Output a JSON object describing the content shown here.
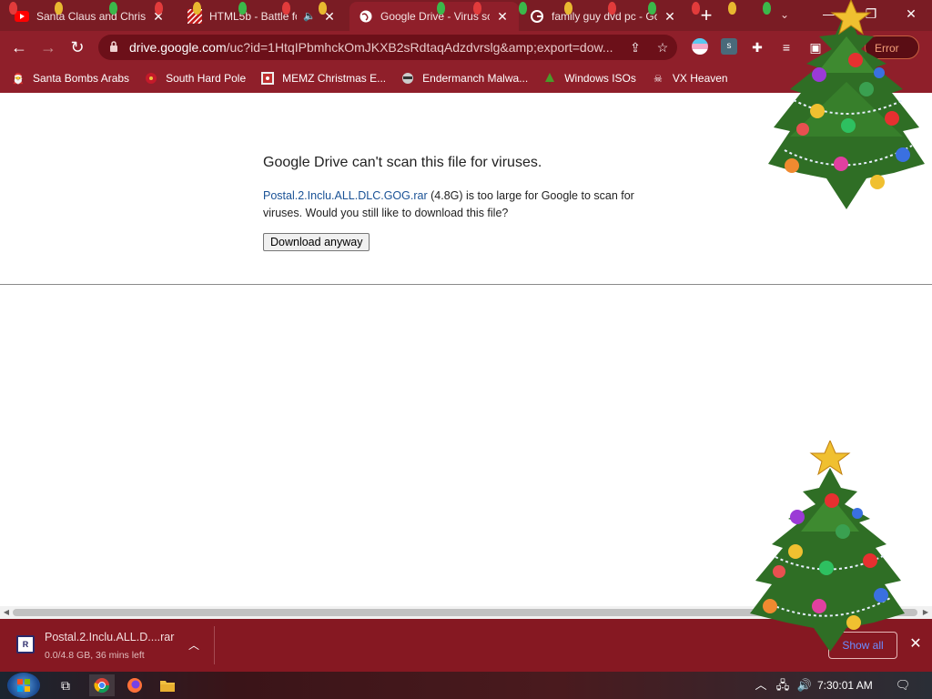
{
  "tabs": [
    {
      "title": "Santa Claus and Christ",
      "favicon": "youtube-icon",
      "active": false
    },
    {
      "title": "HTML5b - Battle fo",
      "favicon": "game-icon",
      "active": false
    },
    {
      "title": "Google Drive - Virus sc",
      "favicon": "globe-icon",
      "active": true
    },
    {
      "title": "family guy dvd pc - Go",
      "favicon": "google-icon",
      "active": false
    }
  ],
  "omnibox": {
    "host": "drive.google.com",
    "path": "/uc?id=1HtqIPbmhckOmJKXB2sRdtaqAdzdvrslg&amp;export=dow..."
  },
  "toolbar": {
    "error_label": "Error"
  },
  "bookmarks": [
    {
      "label": "Santa Bombs Arabs",
      "icon": "santa-icon"
    },
    {
      "label": "South Hard Pole",
      "icon": "ornament-icon"
    },
    {
      "label": "MEMZ Christmas E...",
      "icon": "image-icon"
    },
    {
      "label": "Endermanch Malwa...",
      "icon": "raccoon-icon"
    },
    {
      "label": "Windows ISOs",
      "icon": "tree-icon"
    },
    {
      "label": "VX Heaven",
      "icon": "skull-icon"
    }
  ],
  "page": {
    "heading": "Google Drive can't scan this file for viruses.",
    "file_link": "Postal.2.Inclu.ALL.DLC.GOG.rar",
    "file_size": " (4.8G)",
    "message_tail": " is too large for Google to scan for viruses. Would you still like to download this file?",
    "download_button": "Download anyway"
  },
  "download_shelf": {
    "file_name": "Postal.2.Inclu.ALL.D....rar",
    "status": "0.0/4.8 GB, 36 mins left",
    "show_all": "Show all"
  },
  "taskbar": {
    "clock": "7:30:01 AM"
  },
  "colors": {
    "theme": "#8f1f2a",
    "tabstrip": "#7a1c24",
    "link": "#1a5296",
    "shelf": "#861822"
  }
}
